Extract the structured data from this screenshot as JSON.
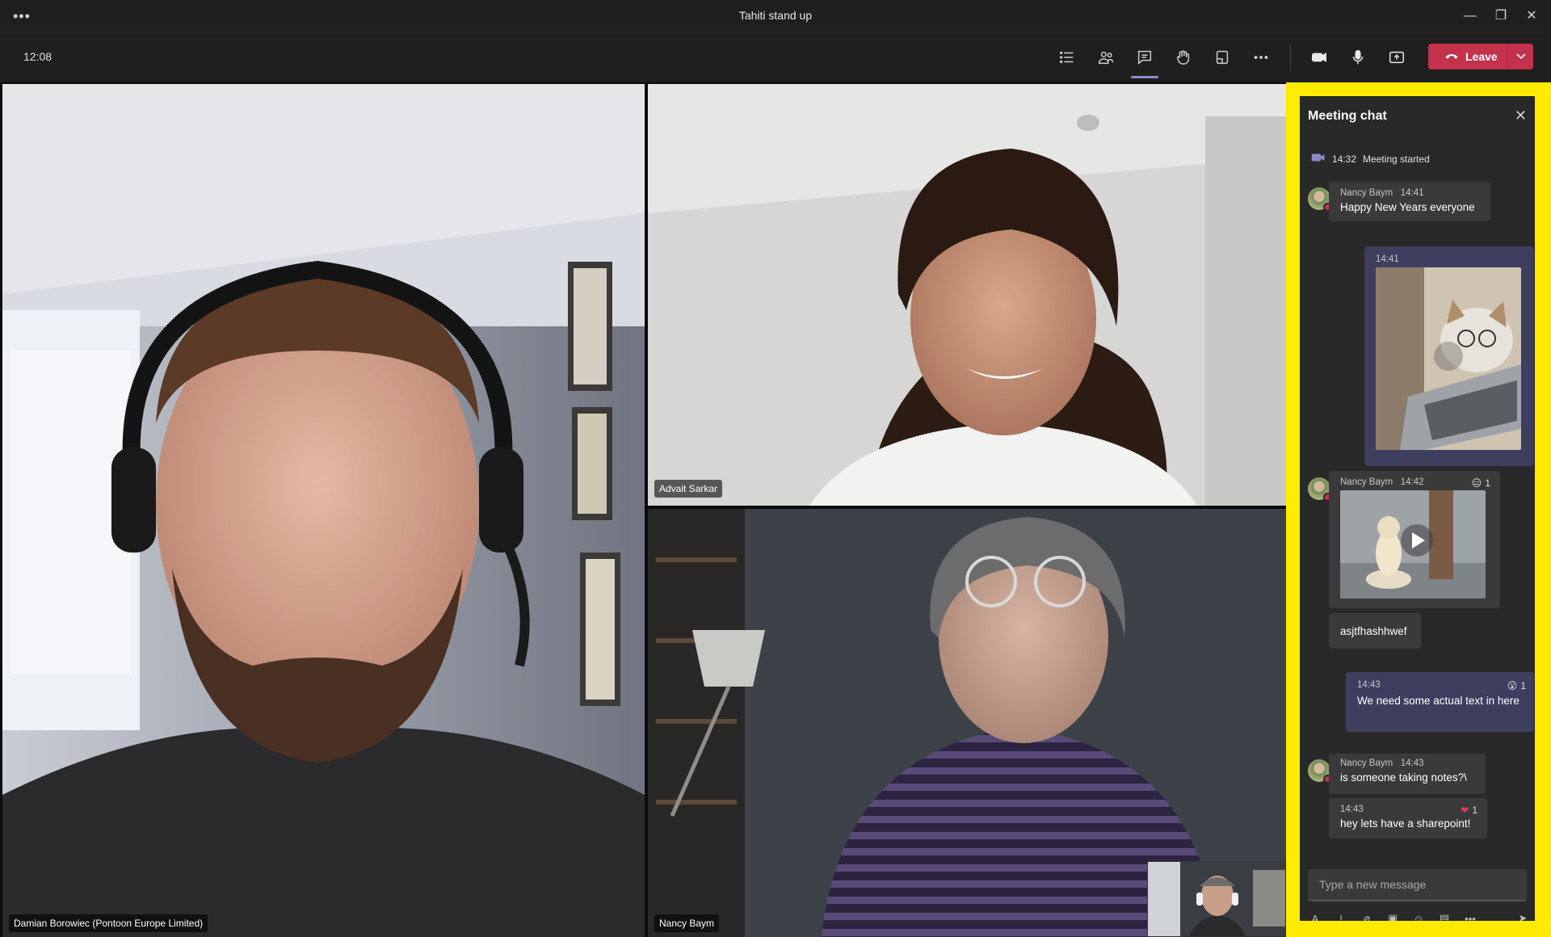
{
  "window": {
    "title": "Tahiti stand up"
  },
  "toolbar": {
    "time": "12:08",
    "leave_label": "Leave"
  },
  "participants": [
    {
      "name": "Damian Borowiec (Pontoon Europe Limited)"
    },
    {
      "name": "Advait Sarkar"
    },
    {
      "name": "Nancy Baym"
    }
  ],
  "chat": {
    "title": "Meeting chat",
    "system": {
      "time": "14:32",
      "text": "Meeting started"
    },
    "messages": [
      {
        "author": "Nancy Baym",
        "time": "14:41",
        "text": "Happy New Years everyone"
      },
      {
        "time": "14:41"
      },
      {
        "author": "Nancy Baym",
        "time": "14:42",
        "reaction_count": "1"
      },
      {
        "text": "asjtfhashhwef"
      },
      {
        "time": "14:43",
        "text": "We need some actual text in here",
        "reaction_count": "1"
      },
      {
        "author": "Nancy Baym",
        "time": "14:43",
        "text": "is someone taking notes?\\"
      },
      {
        "time": "14:43",
        "text": "hey lets have a sharepoint!",
        "reaction_count": "1"
      }
    ],
    "compose_placeholder": "Type a new message"
  },
  "colors": {
    "accent": "#8b8cc7",
    "leave": "#c4314b",
    "highlight": "#ffeb00"
  }
}
